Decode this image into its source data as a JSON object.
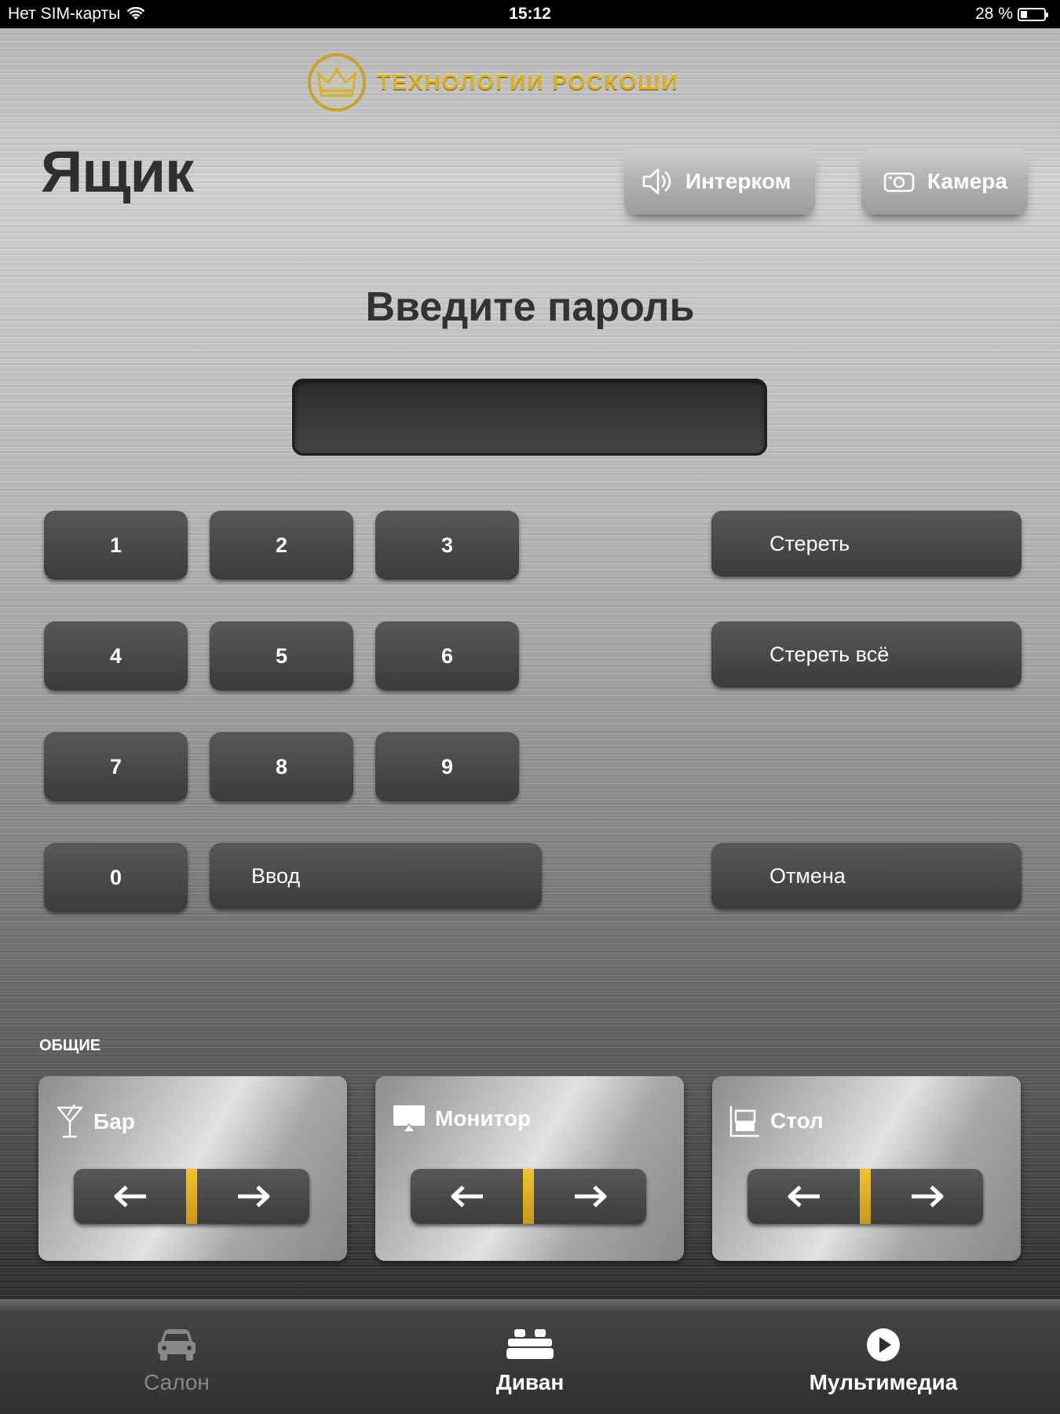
{
  "status_bar": {
    "carrier": "Нет SIM-карты",
    "time": "15:12",
    "battery": "28 %",
    "battery_level": 0.28
  },
  "header": {
    "logo_text": "ТЕХНОЛОГИИ РОСКОШИ",
    "page_title": "Ящик",
    "intercom_label": "Интерком",
    "camera_label": "Камера"
  },
  "keypad": {
    "prompt": "Введите пароль",
    "password_value": "",
    "keys": [
      "1",
      "2",
      "3",
      "4",
      "5",
      "6",
      "7",
      "8",
      "9",
      "0"
    ],
    "enter_label": "Ввод",
    "erase_label": "Стереть",
    "erase_all_label": "Стереть всё",
    "cancel_label": "Отмена"
  },
  "general": {
    "section_label": "ОБЩИЕ",
    "cards": [
      {
        "label": "Бар",
        "icon": "cocktail-icon"
      },
      {
        "label": "Монитор",
        "icon": "monitor-icon"
      },
      {
        "label": "Стол",
        "icon": "table-icon"
      }
    ]
  },
  "tabs": [
    {
      "label": "Салон",
      "icon": "car-icon",
      "active": false
    },
    {
      "label": "Диван",
      "icon": "sofa-icon",
      "active": true
    },
    {
      "label": "Мультимедиа",
      "icon": "play-icon",
      "active": true
    }
  ],
  "colors": {
    "gold": "#d8b12a",
    "button_dark": "#4a4748",
    "inactive_tab": "#888888"
  }
}
